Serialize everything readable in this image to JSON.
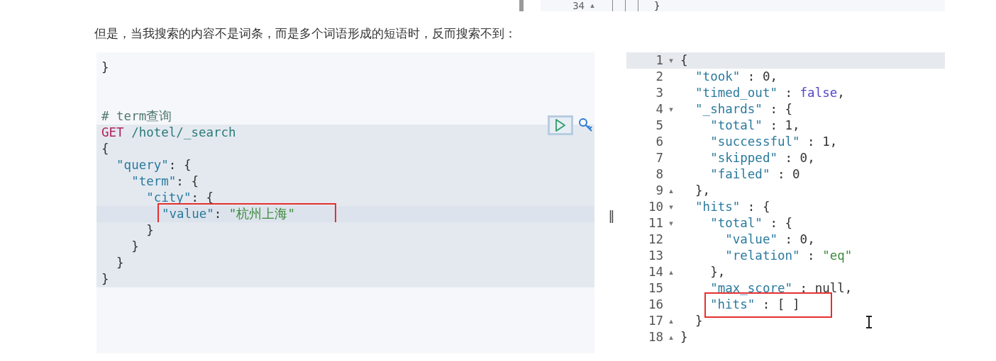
{
  "top_strip": {
    "line_number": "34",
    "fold": "▴",
    "code": "}"
  },
  "paragraph": "但是，当我搜索的内容不是词条，而是多个词语形成的短语时，反而搜索不到：",
  "request_editor": {
    "lines": [
      {
        "active": false,
        "boxed": false,
        "tokens": [
          {
            "kind": "punct",
            "text": "}"
          }
        ]
      },
      {
        "active": false,
        "boxed": false
      },
      {
        "active": false,
        "boxed": false
      },
      {
        "active": false,
        "boxed": false,
        "tokens": [
          {
            "kind": "comment",
            "text": "# term查询"
          }
        ]
      },
      {
        "active": false,
        "boxed": false,
        "block": true,
        "tokens": [
          {
            "kind": "method",
            "text": "GET"
          },
          {
            "kind": "url",
            "text": " /hotel/_search"
          }
        ]
      },
      {
        "active": false,
        "boxed": false,
        "block": true,
        "tokens": [
          {
            "kind": "punct",
            "text": "{"
          }
        ]
      },
      {
        "active": false,
        "boxed": false,
        "block": true,
        "tokens": [
          {
            "kind": "key",
            "text": "  \"query\""
          },
          {
            "kind": "punct",
            "text": ": {"
          }
        ]
      },
      {
        "active": false,
        "boxed": false,
        "block": true,
        "tokens": [
          {
            "kind": "key",
            "text": "    \"term\""
          },
          {
            "kind": "punct",
            "text": ": {"
          }
        ]
      },
      {
        "active": false,
        "boxed": false,
        "block": true,
        "tokens": [
          {
            "kind": "key",
            "text": "      \"city\""
          },
          {
            "kind": "punct",
            "text": ": {"
          }
        ]
      },
      {
        "active": true,
        "boxed": true,
        "block": true,
        "tokens": [
          {
            "kind": "key",
            "text": "\"value\""
          },
          {
            "kind": "punct",
            "text": ": "
          },
          {
            "kind": "string",
            "text": "\"杭州上海\""
          }
        ]
      },
      {
        "active": false,
        "boxed": false,
        "block": true,
        "tokens": [
          {
            "kind": "punct",
            "text": "      }"
          }
        ]
      },
      {
        "active": false,
        "boxed": false,
        "block": true,
        "tokens": [
          {
            "kind": "punct",
            "text": "    }"
          }
        ]
      },
      {
        "active": false,
        "boxed": false,
        "block": true,
        "tokens": [
          {
            "kind": "punct",
            "text": "  }"
          }
        ]
      },
      {
        "active": false,
        "boxed": false,
        "block": true,
        "tokens": [
          {
            "kind": "punct",
            "text": "}"
          }
        ]
      }
    ]
  },
  "splitter": "‖",
  "response_editor": {
    "lines": [
      {
        "number": "1",
        "fold": "▾",
        "active": true,
        "boxed": false,
        "tokens": [
          {
            "kind": "punct",
            "text": "{"
          }
        ]
      },
      {
        "number": "2",
        "active": false,
        "boxed": false,
        "tokens": [
          {
            "kind": "key",
            "text": "  \"took\""
          },
          {
            "kind": "punct",
            "text": " : "
          },
          {
            "kind": "number",
            "text": "0"
          },
          {
            "kind": "punct",
            "text": ","
          }
        ]
      },
      {
        "number": "3",
        "active": false,
        "boxed": false,
        "tokens": [
          {
            "kind": "key",
            "text": "  \"timed_out\""
          },
          {
            "kind": "punct",
            "text": " : "
          },
          {
            "kind": "bool",
            "text": "false"
          },
          {
            "kind": "punct",
            "text": ","
          }
        ]
      },
      {
        "number": "4",
        "fold": "▾",
        "active": false,
        "boxed": false,
        "tokens": [
          {
            "kind": "key",
            "text": "  \"_shards\""
          },
          {
            "kind": "punct",
            "text": " : {"
          }
        ]
      },
      {
        "number": "5",
        "active": false,
        "boxed": false,
        "tokens": [
          {
            "kind": "key",
            "text": "    \"total\""
          },
          {
            "kind": "punct",
            "text": " : "
          },
          {
            "kind": "number",
            "text": "1"
          },
          {
            "kind": "punct",
            "text": ","
          }
        ]
      },
      {
        "number": "6",
        "active": false,
        "boxed": false,
        "tokens": [
          {
            "kind": "key",
            "text": "    \"successful\""
          },
          {
            "kind": "punct",
            "text": " : "
          },
          {
            "kind": "number",
            "text": "1"
          },
          {
            "kind": "punct",
            "text": ","
          }
        ]
      },
      {
        "number": "7",
        "active": false,
        "boxed": false,
        "tokens": [
          {
            "kind": "key",
            "text": "    \"skipped\""
          },
          {
            "kind": "punct",
            "text": " : "
          },
          {
            "kind": "number",
            "text": "0"
          },
          {
            "kind": "punct",
            "text": ","
          }
        ]
      },
      {
        "number": "8",
        "active": false,
        "boxed": false,
        "tokens": [
          {
            "kind": "key",
            "text": "    \"failed\""
          },
          {
            "kind": "punct",
            "text": " : "
          },
          {
            "kind": "number",
            "text": "0"
          }
        ]
      },
      {
        "number": "9",
        "fold": "▴",
        "active": false,
        "boxed": false,
        "tokens": [
          {
            "kind": "punct",
            "text": "  },"
          }
        ]
      },
      {
        "number": "10",
        "fold": "▾",
        "active": false,
        "boxed": false,
        "tokens": [
          {
            "kind": "key",
            "text": "  \"hits\""
          },
          {
            "kind": "punct",
            "text": " : {"
          }
        ]
      },
      {
        "number": "11",
        "fold": "▾",
        "active": false,
        "boxed": false,
        "tokens": [
          {
            "kind": "key",
            "text": "    \"total\""
          },
          {
            "kind": "punct",
            "text": " : {"
          }
        ]
      },
      {
        "number": "12",
        "active": false,
        "boxed": false,
        "tokens": [
          {
            "kind": "key",
            "text": "      \"value\""
          },
          {
            "kind": "punct",
            "text": " : "
          },
          {
            "kind": "number",
            "text": "0"
          },
          {
            "kind": "punct",
            "text": ","
          }
        ]
      },
      {
        "number": "13",
        "active": false,
        "boxed": false,
        "tokens": [
          {
            "kind": "key",
            "text": "      \"relation\""
          },
          {
            "kind": "punct",
            "text": " : "
          },
          {
            "kind": "string",
            "text": "\"eq\""
          }
        ]
      },
      {
        "number": "14",
        "fold": "▴",
        "active": false,
        "boxed": false,
        "tokens": [
          {
            "kind": "punct",
            "text": "    },"
          }
        ]
      },
      {
        "number": "15",
        "active": false,
        "boxed": false,
        "tokens": [
          {
            "kind": "key",
            "text": "    \"max_score\""
          },
          {
            "kind": "punct",
            "text": " : "
          },
          {
            "kind": "null",
            "text": "null"
          },
          {
            "kind": "punct",
            "text": ","
          }
        ]
      },
      {
        "number": "16",
        "active": false,
        "boxed": true,
        "tokens": [
          {
            "kind": "key",
            "text": "\"hits\""
          },
          {
            "kind": "punct",
            "text": " : [ ]"
          }
        ]
      },
      {
        "number": "17",
        "fold": "▴",
        "active": false,
        "boxed": false,
        "tokens": [
          {
            "kind": "punct",
            "text": "  }"
          }
        ]
      },
      {
        "number": "18",
        "fold": "▴",
        "active": false,
        "boxed": false,
        "tokens": [
          {
            "kind": "punct",
            "text": "}"
          }
        ]
      }
    ]
  }
}
